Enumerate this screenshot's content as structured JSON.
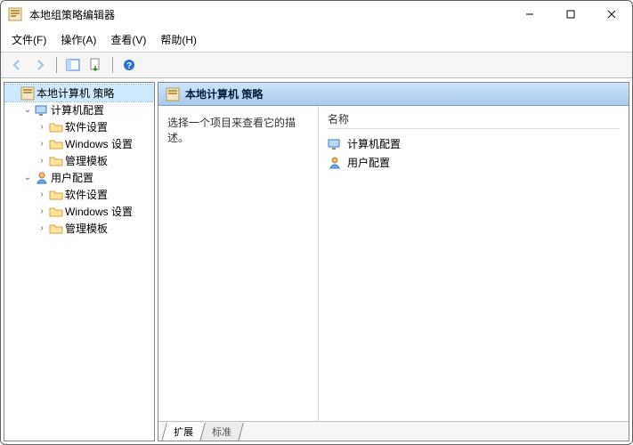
{
  "titlebar": {
    "title": "本地组策略编辑器"
  },
  "menu": {
    "file": "文件(F)",
    "action": "操作(A)",
    "view": "查看(V)",
    "help": "帮助(H)"
  },
  "tree": {
    "root": {
      "label": "本地计算机 策略"
    },
    "computer": {
      "label": "计算机配置"
    },
    "user": {
      "label": "用户配置"
    },
    "nodes": {
      "software": "软件设置",
      "windows": "Windows 设置",
      "templates": "管理模板"
    }
  },
  "header": {
    "title": "本地计算机 策略"
  },
  "desc": {
    "text": "选择一个项目来查看它的描述。"
  },
  "list": {
    "column_name": "名称",
    "items": [
      {
        "label": "计算机配置",
        "icon": "computer"
      },
      {
        "label": "用户配置",
        "icon": "user"
      }
    ]
  },
  "tabs": {
    "extended": "扩展",
    "standard": "标准"
  }
}
